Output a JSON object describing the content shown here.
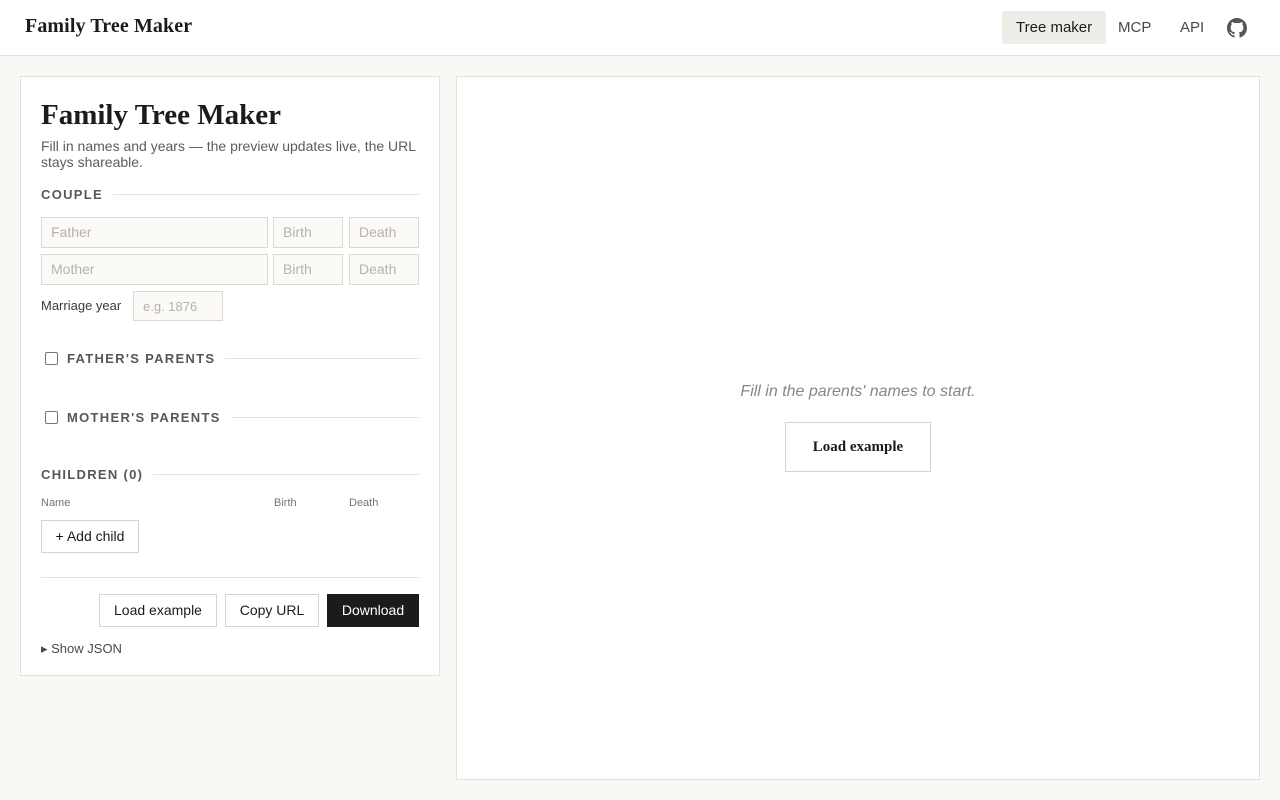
{
  "header": {
    "brand": "Family Tree Maker",
    "nav": [
      {
        "label": "Tree maker",
        "active": true
      },
      {
        "label": "MCP",
        "active": false
      },
      {
        "label": "API",
        "active": false
      }
    ],
    "github_icon": "github-icon"
  },
  "form": {
    "title": "Family Tree Maker",
    "subtitle": "Fill in names and years — the preview updates live, the URL stays shareable.",
    "couple": {
      "heading": "COUPLE",
      "father": {
        "placeholder": "Father",
        "value": ""
      },
      "father_birth": {
        "placeholder": "Birth",
        "value": ""
      },
      "father_death": {
        "placeholder": "Death",
        "value": ""
      },
      "mother": {
        "placeholder": "Mother",
        "value": ""
      },
      "mother_birth": {
        "placeholder": "Birth",
        "value": ""
      },
      "mother_death": {
        "placeholder": "Death",
        "value": ""
      },
      "marriage_label": "Marriage year",
      "marriage_placeholder": "e.g. 1876"
    },
    "fathers_parents": {
      "heading": "FATHER'S PARENTS",
      "checked": false
    },
    "mothers_parents": {
      "heading": "MOTHER'S PARENTS",
      "checked": false
    },
    "children": {
      "heading": "CHILDREN (0)",
      "columns": [
        "Name",
        "Birth",
        "Death"
      ],
      "add_label": "+ Add child"
    },
    "actions": {
      "load_example": "Load example",
      "copy_url": "Copy URL",
      "download": "Download"
    },
    "show_json": "▸ Show JSON"
  },
  "preview": {
    "empty_message": "Fill in the parents' names to start.",
    "load_example": "Load example"
  },
  "colors": {
    "background": "#f9f8f5",
    "primary_button": "#1c1b19",
    "active_nav": "#efede7"
  }
}
